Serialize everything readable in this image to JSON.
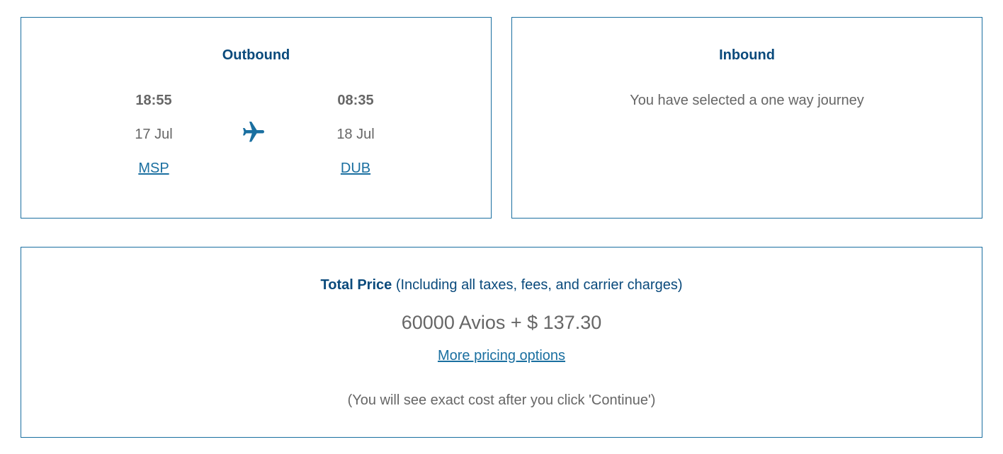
{
  "outbound": {
    "heading": "Outbound",
    "departure": {
      "time": "18:55",
      "date": "17 Jul",
      "airport": "MSP"
    },
    "arrival": {
      "time": "08:35",
      "date": "18 Jul",
      "airport": "DUB"
    },
    "icon": "plane-icon"
  },
  "inbound": {
    "heading": "Inbound",
    "message": "You have selected a one way journey"
  },
  "price": {
    "label_strong": "Total Price",
    "label_detail": " (Including all taxes, fees, and carrier charges)",
    "value": "60000 Avios + $ 137.30",
    "more_options_link": "More pricing options",
    "note": "(You will see exact cost after you click 'Continue')"
  },
  "colors": {
    "border": "#1a6fa0",
    "heading": "#0a4a7c",
    "link": "#1a6fa0",
    "text": "#666666"
  }
}
